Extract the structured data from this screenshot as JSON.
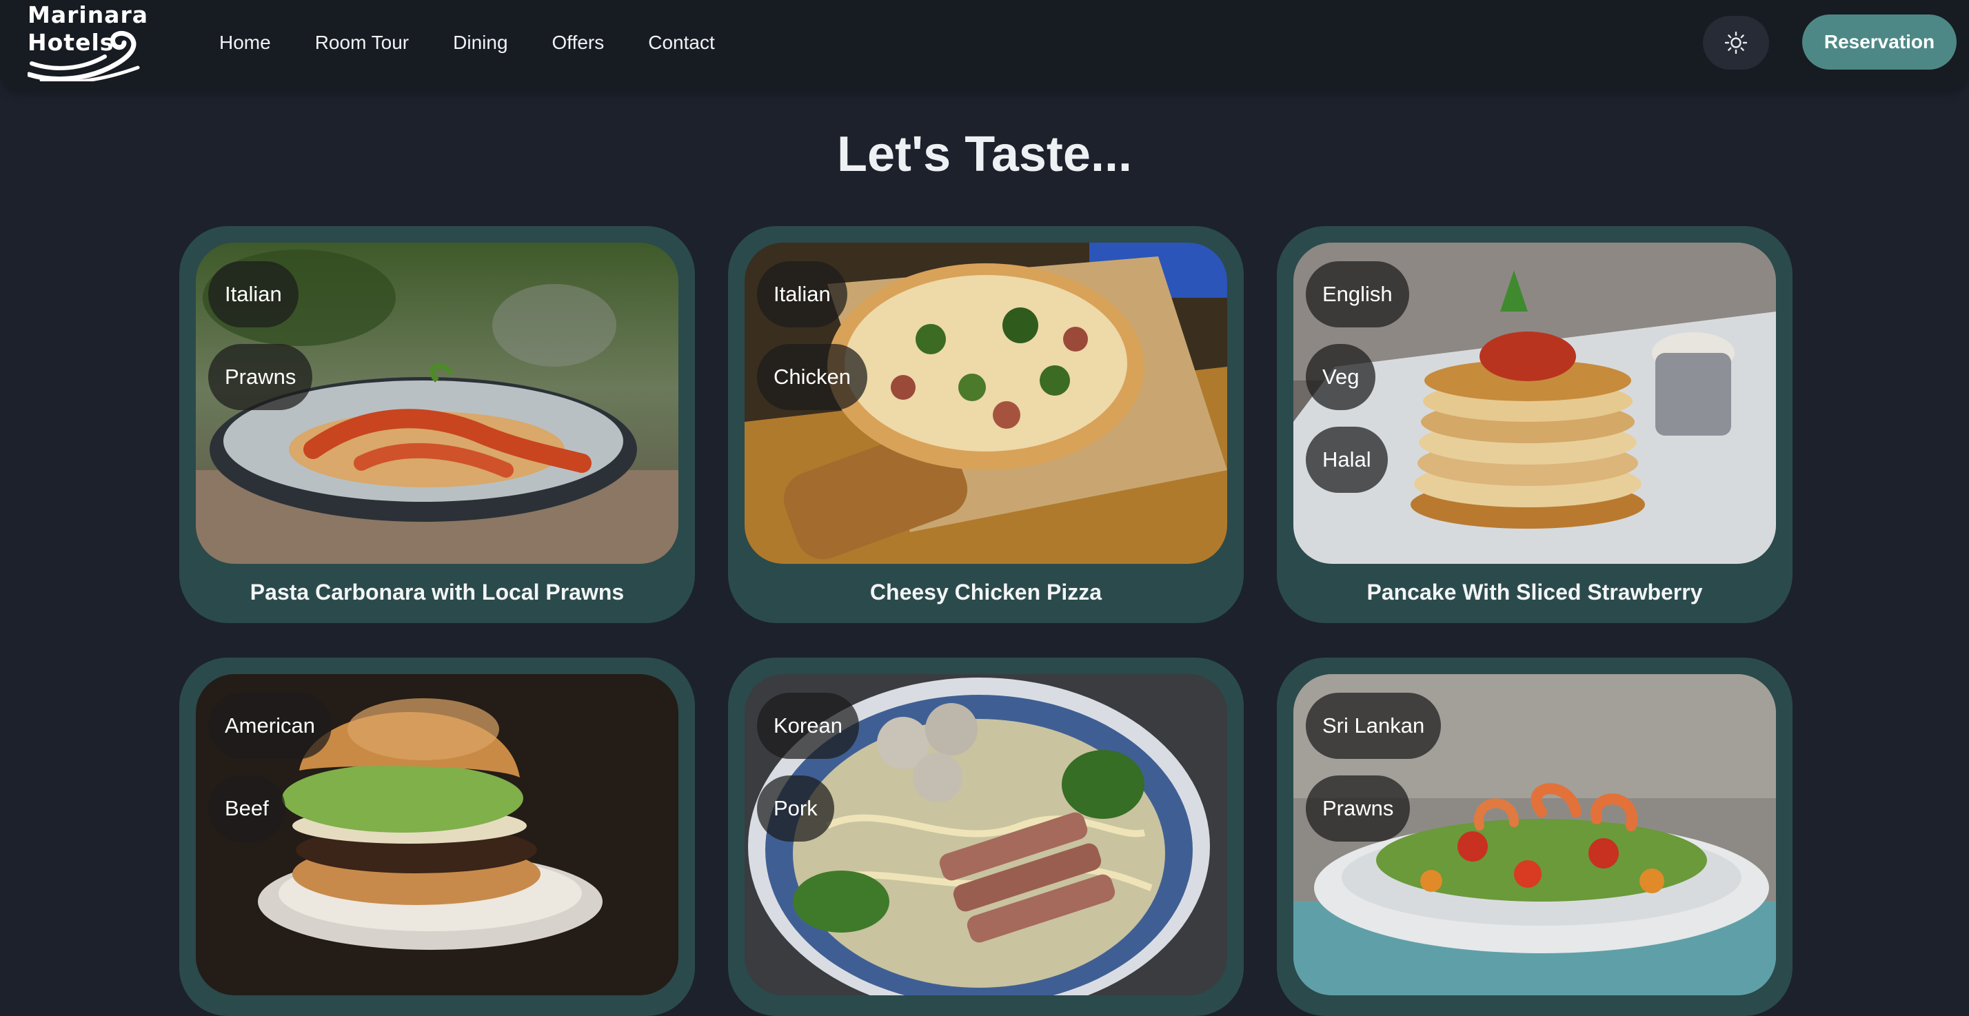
{
  "brand": {
    "line1": "Marinara",
    "line2": "Hotels"
  },
  "nav": {
    "links": [
      "Home",
      "Room Tour",
      "Dining",
      "Offers",
      "Contact"
    ],
    "theme_icon": "sun-icon",
    "reservation_label": "Reservation"
  },
  "page": {
    "title": "Let's Taste..."
  },
  "dishes": [
    {
      "title": "Pasta Carbonara with Local Prawns",
      "tags": [
        "Italian",
        "Prawns"
      ]
    },
    {
      "title": "Cheesy Chicken Pizza",
      "tags": [
        "Italian",
        "Chicken"
      ]
    },
    {
      "title": "Pancake With Sliced Strawberry",
      "tags": [
        "English",
        "Veg",
        "Halal"
      ]
    },
    {
      "title": "",
      "tags": [
        "American",
        "Beef"
      ]
    },
    {
      "title": "",
      "tags": [
        "Korean",
        "Pork"
      ]
    },
    {
      "title": "",
      "tags": [
        "Sri Lankan",
        "Prawns"
      ]
    }
  ],
  "colors": {
    "background": "#1c212b",
    "navbar": "#171b22",
    "card": "#2b4a4c",
    "accent": "#4d8886"
  }
}
